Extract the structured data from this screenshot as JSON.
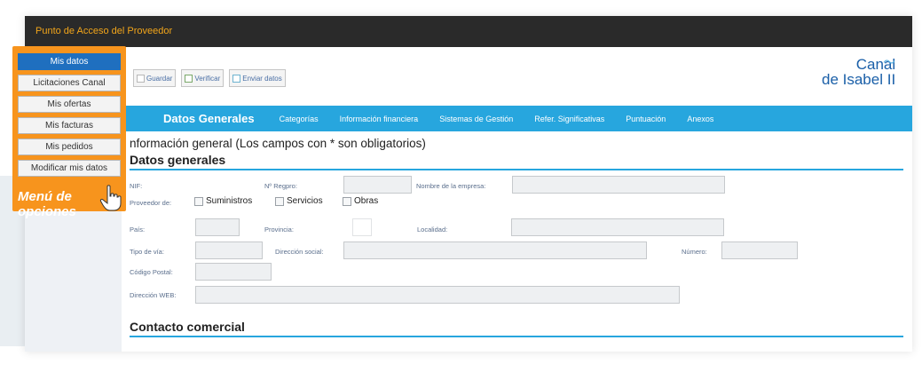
{
  "app": {
    "title": "Punto de Acceso del Proveedor"
  },
  "toolbar": {
    "save": "Guardar",
    "verify": "Verificar",
    "send": "Enviar datos"
  },
  "logo": {
    "line1": "Canal",
    "line2": "de Isabel II"
  },
  "tabs": [
    "Datos Generales",
    "Categorías",
    "Información financiera",
    "Sistemas de Gestión",
    "Refer. Significativas",
    "Puntuación",
    "Anexos"
  ],
  "form": {
    "info_title": "nformación general (Los campos con * son obligatorios)",
    "section_general": "Datos generales",
    "nif": "NIF:",
    "nregpro": "Nº Regpro:",
    "nombre_empresa": "Nombre de la empresa:",
    "proveedor_de": "Proveedor de:",
    "suministros": "Suministros",
    "servicios": "Servicios",
    "obras": "Obras",
    "pais": "País:",
    "provincia": "Provincia:",
    "localidad": "Localidad:",
    "tipo_via": "Tipo de vía:",
    "direccion_social": "Dirección social:",
    "numero": "Número:",
    "codigo_postal": "Código Postal:",
    "direccion_web": "Dirección WEB:",
    "section_contacto": "Contacto comercial"
  },
  "menu": {
    "items": [
      "Mis datos",
      "Licitaciones Canal",
      "Mis ofertas",
      "Mis facturas",
      "Mis pedidos",
      "Modificar mis datos"
    ],
    "caption_line1": "Menú de",
    "caption_line2": "opciones"
  },
  "colors": {
    "accent": "#27a6de",
    "orange": "#f7941d",
    "active": "#1f6fbf",
    "topbar": "#2a2a2a"
  }
}
